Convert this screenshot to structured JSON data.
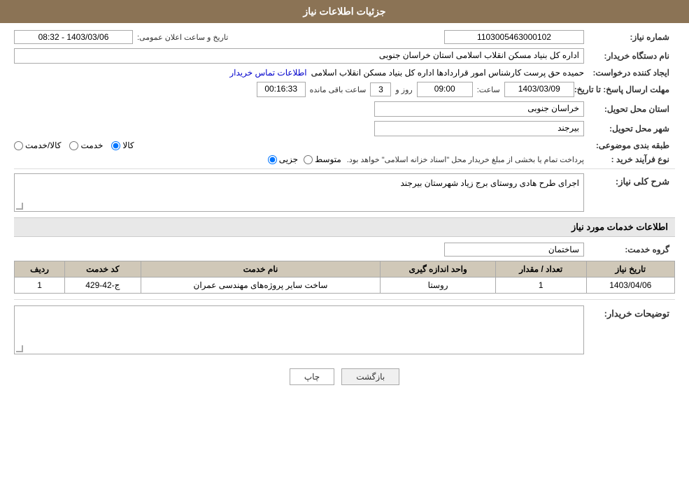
{
  "header": {
    "title": "جزئیات اطلاعات نیاز"
  },
  "fields": {
    "request_number_label": "شماره نیاز:",
    "request_number_value": "1103005463000102",
    "buyer_org_label": "نام دستگاه خریدار:",
    "buyer_org_value": "اداره کل بنیاد مسکن انقلاب اسلامی استان خراسان جنوبی",
    "creator_label": "ایجاد کننده درخواست:",
    "creator_name": "حمیده حق پرست کارشناس امور قراردادها اداره کل بنیاد مسکن انقلاب اسلامی",
    "creator_contact_link": "اطلاعات تماس خریدار",
    "deadline_label": "مهلت ارسال پاسخ: تا تاریخ:",
    "deadline_date": "1403/03/09",
    "deadline_time_label": "ساعت:",
    "deadline_time": "09:00",
    "deadline_day_label": "روز و",
    "deadline_days": "3",
    "deadline_remaining_label": "ساعت باقی مانده",
    "deadline_remaining": "00:16:33",
    "announce_label": "تاریخ و ساعت اعلان عمومی:",
    "announce_value": "1403/03/06 - 08:32",
    "province_label": "استان محل تحویل:",
    "province_value": "خراسان جنوبی",
    "city_label": "شهر محل تحویل:",
    "city_value": "بیرجند",
    "category_label": "طبقه بندی موضوعی:",
    "category_kala": "کالا",
    "category_khedmat": "خدمت",
    "category_kala_khedmat": "کالا/خدمت",
    "purchase_type_label": "نوع فرآیند خرید :",
    "purchase_jozei": "جزیی",
    "purchase_motavaset": "متوسط",
    "purchase_note": "پرداخت تمام یا بخشی از مبلغ خریدار محل \"اسناد خزانه اسلامی\" خواهد بود.",
    "description_label": "شرح کلی نیاز:",
    "description_value": "اجرای طرح هادی روستای برج زیاد شهرستان بیرجند",
    "services_section_label": "اطلاعات خدمات مورد نیاز",
    "service_group_label": "گروه خدمت:",
    "service_group_value": "ساختمان",
    "table_headers": {
      "row_num": "ردیف",
      "service_code": "کد خدمت",
      "service_name": "نام خدمت",
      "unit": "واحد اندازه گیری",
      "quantity": "تعداد / مقدار",
      "date": "تاریخ نیاز"
    },
    "table_rows": [
      {
        "row_num": "1",
        "service_code": "ج-42-429",
        "service_name": "ساخت سایر پروژه‌های مهندسی عمران",
        "unit": "روستا",
        "quantity": "1",
        "date": "1403/04/06"
      }
    ],
    "buyer_notes_label": "توضیحات خریدار:",
    "buyer_notes_value": ""
  },
  "buttons": {
    "print_label": "چاپ",
    "back_label": "بازگشت"
  }
}
